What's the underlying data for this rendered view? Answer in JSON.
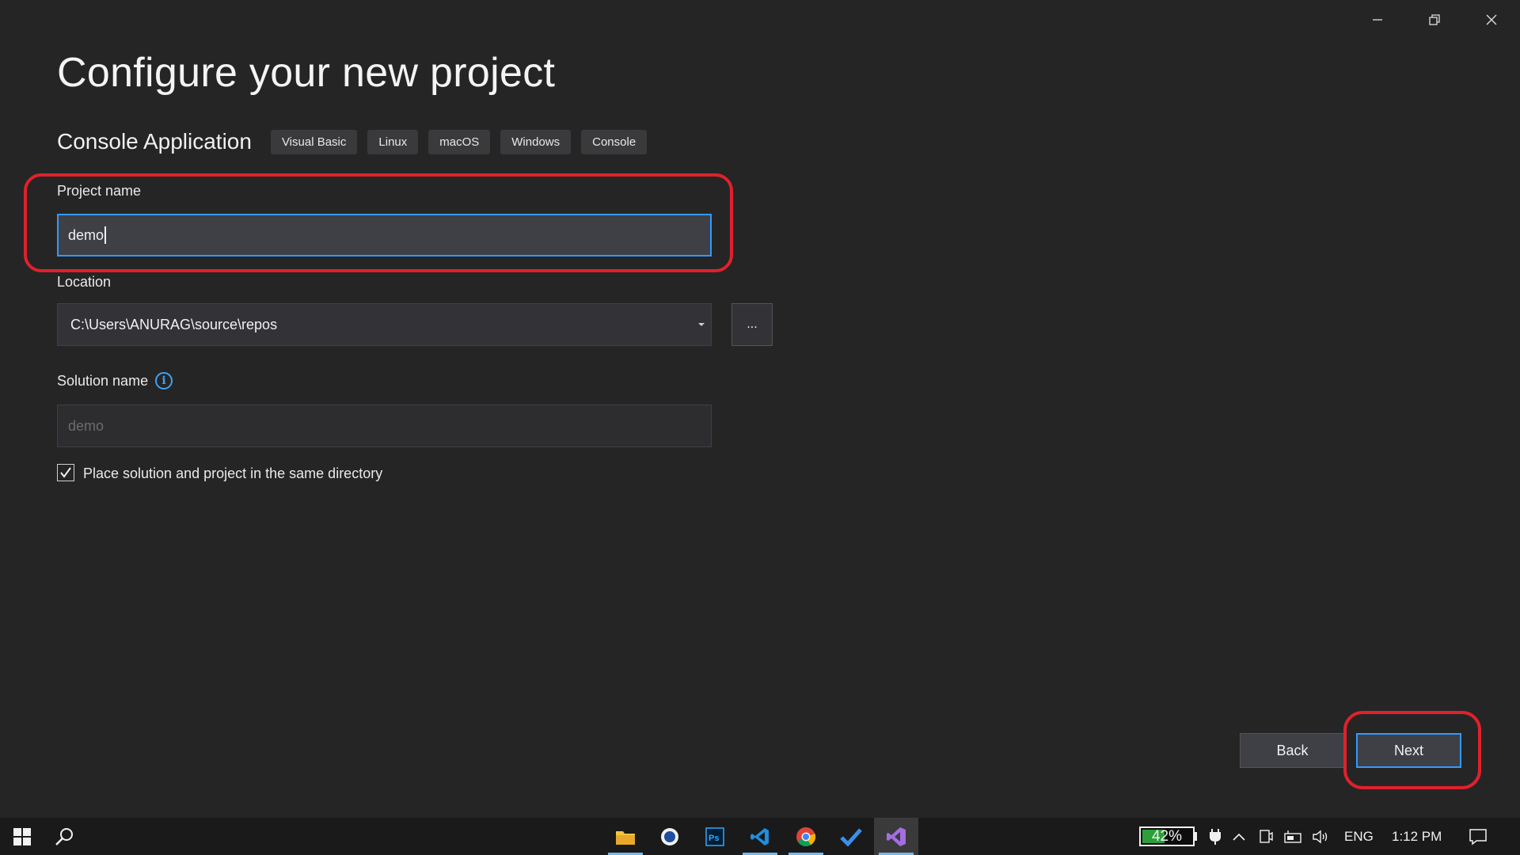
{
  "window": {
    "controls": [
      "minimize-icon",
      "restore-icon",
      "close-icon"
    ]
  },
  "page": {
    "title": "Configure your new project"
  },
  "template": {
    "name": "Console Application",
    "tags": [
      "Visual Basic",
      "Linux",
      "macOS",
      "Windows",
      "Console"
    ]
  },
  "form": {
    "project_name": {
      "label": "Project name",
      "value": "demo"
    },
    "location": {
      "label": "Location",
      "value": "C:\\Users\\ANURAG\\source\\repos",
      "browse_label": "..."
    },
    "solution_name": {
      "label": "Solution name",
      "placeholder": "demo"
    },
    "same_directory": {
      "label": "Place solution and project in the same directory",
      "checked": true
    }
  },
  "buttons": {
    "back": "Back",
    "next": "Next"
  },
  "taskbar": {
    "apps": [
      "file-explorer-icon",
      "app-icon",
      "photoshop-icon",
      "vscode-icon",
      "chrome-icon",
      "todo-icon",
      "visual-studio-icon"
    ],
    "battery_percent": "42%",
    "battery_level": 0.42,
    "language": "ENG",
    "time": "1:12 PM"
  },
  "colors": {
    "background": "#252526",
    "accent": "#3399ff",
    "highlight": "#e0212b",
    "info": "#3ea3f3"
  }
}
